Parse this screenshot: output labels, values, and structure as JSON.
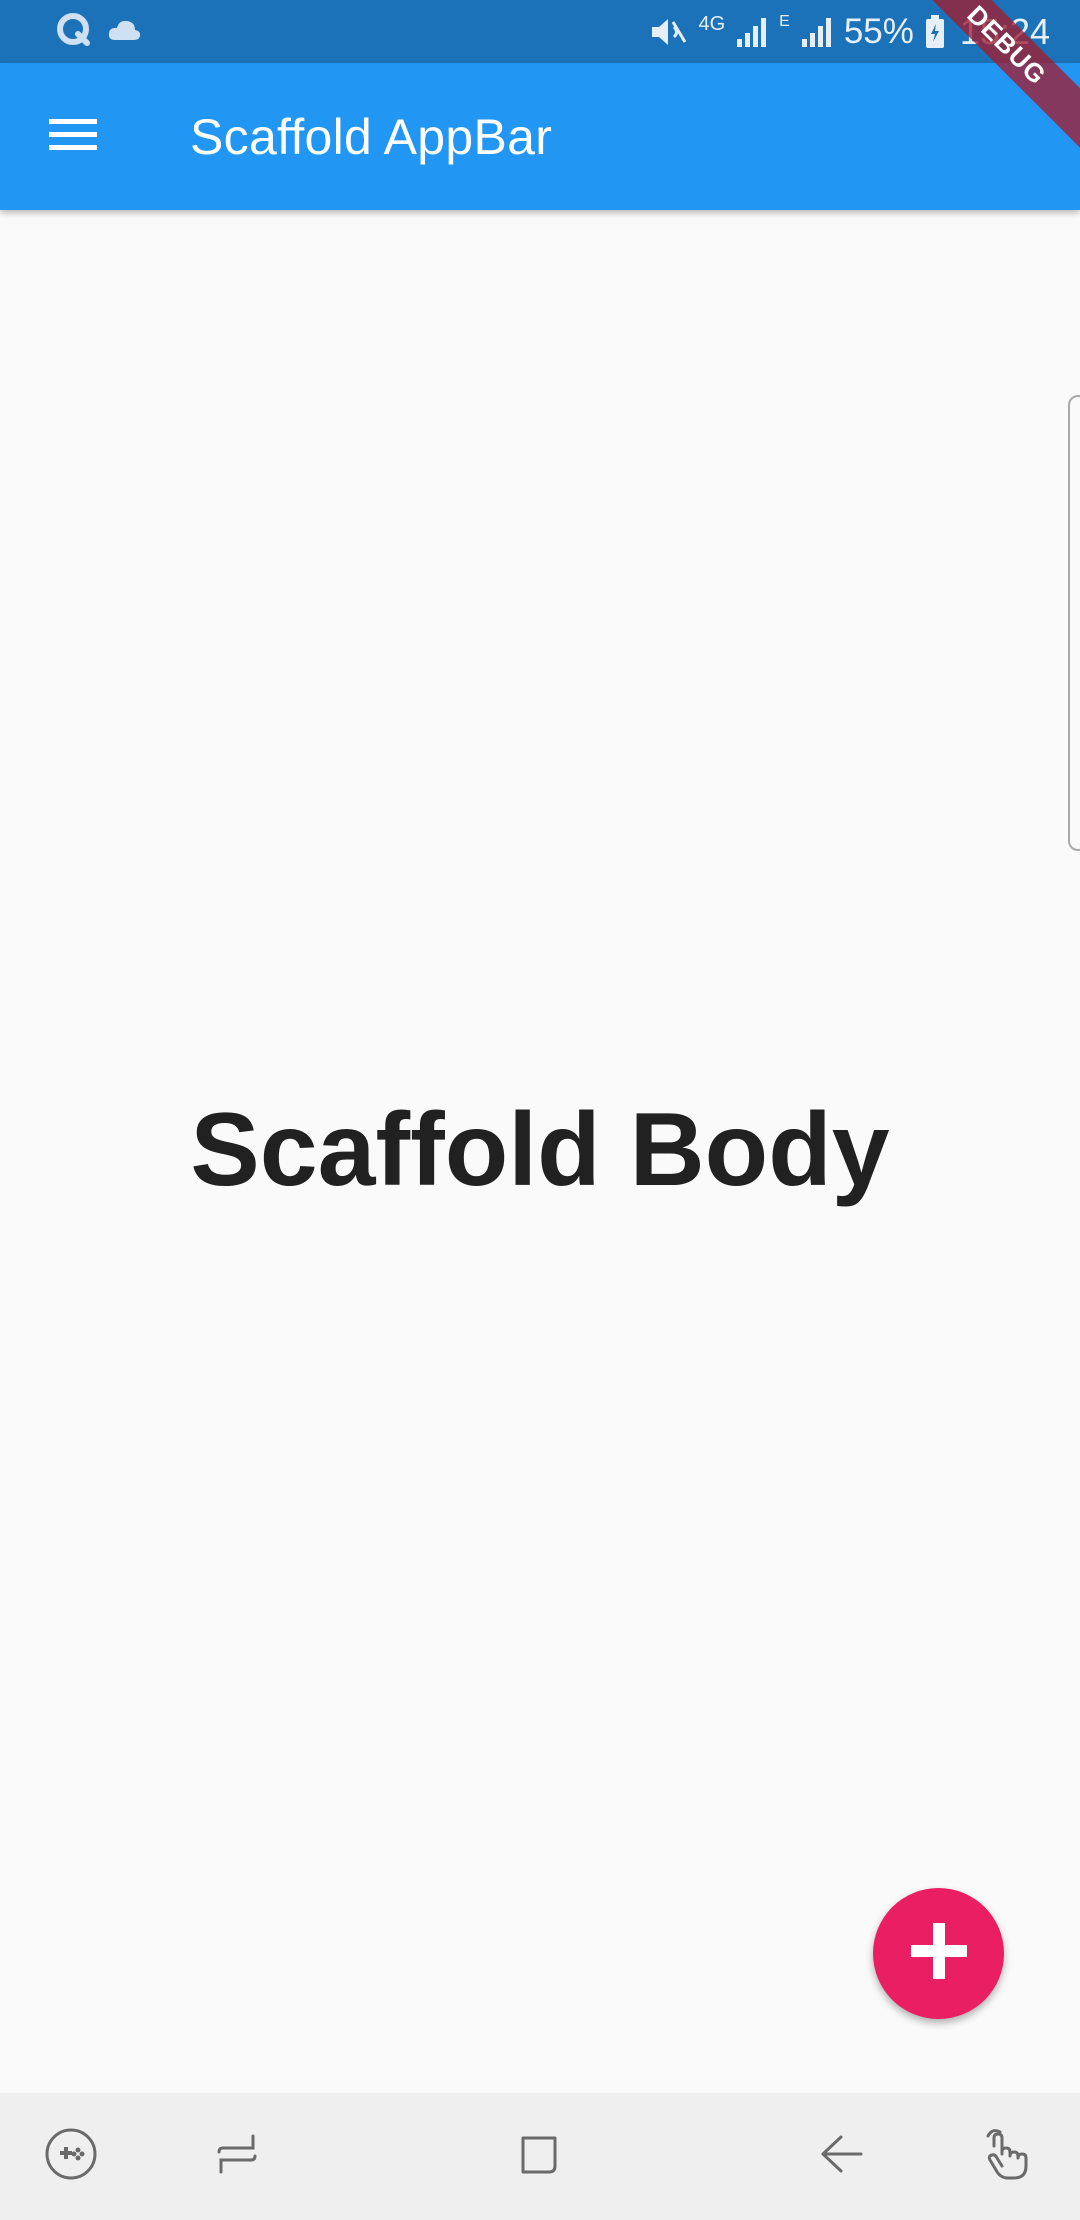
{
  "status_bar": {
    "battery": "55%",
    "time": "15:24",
    "network": "4G",
    "network_secondary": "E",
    "icons": [
      "quik-icon",
      "cloud-icon",
      "mute-icon",
      "signal-icon",
      "signal-icon",
      "battery-icon"
    ]
  },
  "app_bar": {
    "title": "Scaffold AppBar",
    "menu_icon": "menu-icon",
    "background": "#2196f3"
  },
  "debug_banner": {
    "label": "DEBUG"
  },
  "body": {
    "text": "Scaffold Body"
  },
  "fab": {
    "icon": "plus-icon",
    "color": "#e91e63"
  },
  "nav_bar": {
    "buttons": [
      "game-launcher-icon",
      "recents-icon",
      "home-icon",
      "back-icon",
      "touch-icon"
    ]
  }
}
